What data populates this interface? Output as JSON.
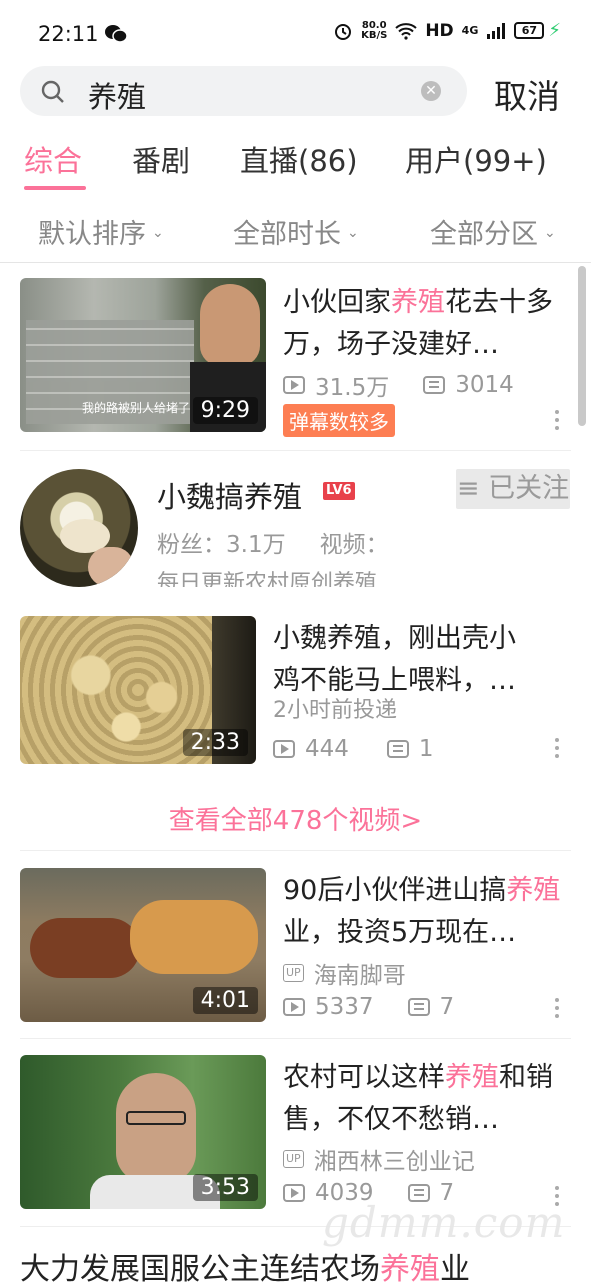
{
  "status": {
    "time": "22:11",
    "net_speed_value": "80.0",
    "net_speed_unit": "KB/S",
    "hd": "HD",
    "network": "4G",
    "battery": "67"
  },
  "search": {
    "query": "养殖",
    "cancel": "取消"
  },
  "tabs": [
    "综合",
    "番剧",
    "直播(86)",
    "用户(99+)"
  ],
  "filters": [
    "默认排序",
    "全部时长",
    "全部分区"
  ],
  "videos": [
    {
      "title_pre": "小伙回家",
      "title_hl": "养殖",
      "title_post": "花去十多万，场子没建好…",
      "thumb_caption": "我的路被别人给堵了",
      "duration": "9:29",
      "plays": "31.5万",
      "danmaku": "3014",
      "badge": "弹幕数较多"
    },
    {
      "title_line1": "小魏养殖，刚出壳小",
      "title_line2": "鸡不能马上喂料，…",
      "time_ago": "2小时前投递",
      "duration": "2:33",
      "plays": "444",
      "danmaku": "1"
    },
    {
      "title_pre": "90后小伙伴进山搞",
      "title_hl": "养殖",
      "title_post": "业，投资5万现在…",
      "uploader": "海南脚哥",
      "duration": "4:01",
      "plays": "5337",
      "danmaku": "7"
    },
    {
      "title_pre": "农村可以这样",
      "title_hl": "养殖",
      "title_post": "和销售，不仅不愁销…",
      "uploader": "湘西林三创业记",
      "duration": "3:53",
      "plays": "4039",
      "danmaku": "7"
    }
  ],
  "user": {
    "name": "小魏搞养殖",
    "level": "LV6",
    "follow_status": "≡ 已关注",
    "fans_label": "粉丝：3.1万",
    "videos_label": "视频：",
    "bio": "每日更新农村原创养殖"
  },
  "view_all": "查看全部478个视频>",
  "bottom_title_pre": "大力发展国服公主连结农场",
  "bottom_title_hl": "养殖",
  "bottom_title_post": "业",
  "watermark": "gdmm.com",
  "colors": {
    "accent": "#fb7299",
    "badge": "#fd7e53",
    "level": "#e8414b"
  }
}
